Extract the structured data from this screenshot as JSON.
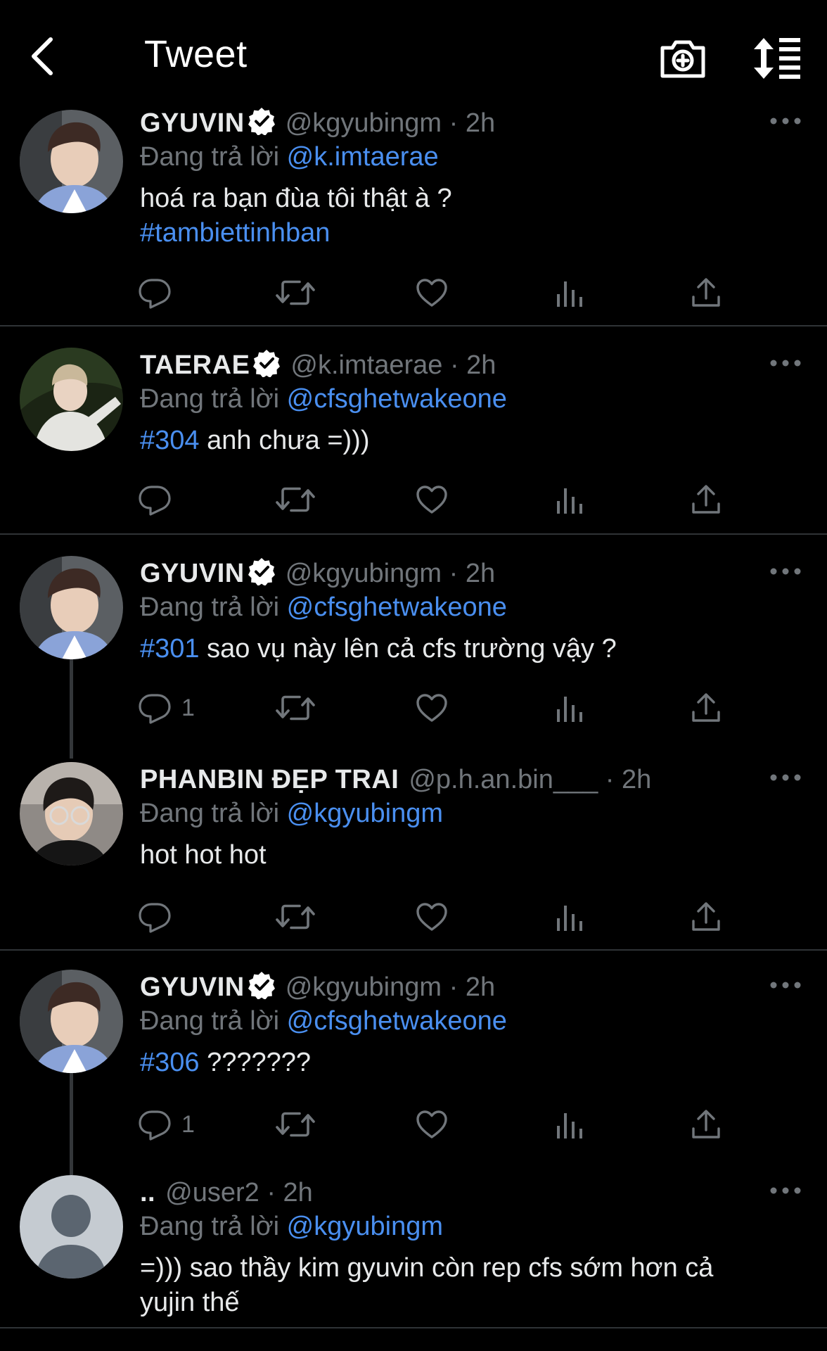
{
  "header": {
    "title": "Tweet"
  },
  "icons": {
    "back": "chevron-left-icon",
    "camera": "camera-plus-icon",
    "sort": "sort-icon",
    "reply": "reply-icon",
    "retweet": "retweet-icon",
    "like": "heart-icon",
    "analytics": "bar-chart-icon",
    "share": "share-icon",
    "more": "more-icon",
    "verified": "verified-badge-icon"
  },
  "colors": {
    "background": "#000000",
    "link": "#4a8ff0",
    "muted": "#71767b",
    "verified": "#ffffff"
  },
  "tweets": [
    {
      "name": "GYUVIN",
      "verified": true,
      "handle": "@kgyubingm · 2h",
      "reply_prefix": "Đang trả lời",
      "reply_to": "@k.imtaerae",
      "body_text": "hoá ra bạn đùa tôi thật à ?",
      "body_tag": "#tambiettinhban",
      "reply_count": ""
    },
    {
      "name": "TAERAE",
      "verified": true,
      "handle": "@k.imtaerae · 2h",
      "reply_prefix": "Đang trả lời",
      "reply_to": "@cfsghetwakeone",
      "body_tag": "#304",
      "body_text": " anh chưa =)))",
      "reply_count": ""
    },
    {
      "name": "GYUVIN",
      "verified": true,
      "handle": "@kgyubingm · 2h",
      "reply_prefix": "Đang trả lời",
      "reply_to": "@cfsghetwakeone",
      "body_tag": "#301",
      "body_text": " sao vụ này lên cả cfs trường vậy ?",
      "reply_count": "1"
    },
    {
      "name": "PHANBIN ĐẸP TRAI",
      "verified": false,
      "handle": "@p.h.an.bin___ · 2h",
      "reply_prefix": "Đang trả lời",
      "reply_to": "@kgyubingm",
      "body_text": "hot hot hot",
      "reply_count": ""
    },
    {
      "name": "GYUVIN",
      "verified": true,
      "handle": "@kgyubingm · 2h",
      "reply_prefix": "Đang trả lời",
      "reply_to": "@cfsghetwakeone",
      "body_tag": "#306",
      "body_text": " ???????",
      "reply_count": "1"
    },
    {
      "name": "..",
      "verified": false,
      "handle": "@user2 · 2h",
      "reply_prefix": "Đang trả lời",
      "reply_to": "@kgyubingm",
      "body_text_1": "=))) sao thầy kim gyuvin còn rep cfs sớm hơn cả",
      "body_text_2": "yujin thế"
    }
  ]
}
